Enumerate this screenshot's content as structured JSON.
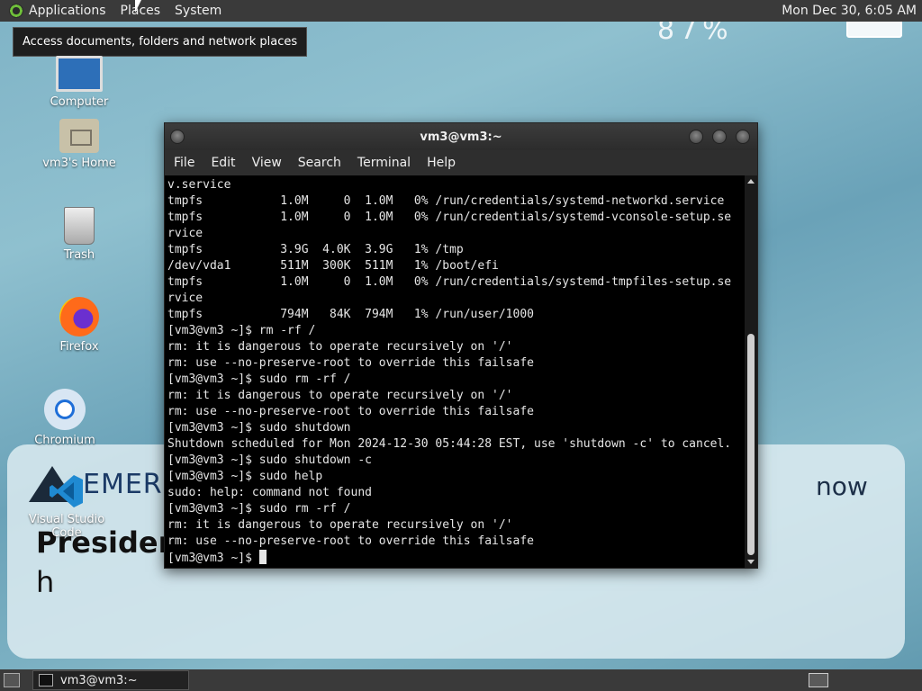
{
  "top_panel": {
    "menus": [
      "Applications",
      "Places",
      "System"
    ],
    "clock": "Mon Dec 30,  6:05 AM"
  },
  "tooltip": "Access documents, folders and network places",
  "wallpaper": {
    "brand": "EMER",
    "now": "now",
    "presider": "Presider",
    "h": "h",
    "status_text": "87%"
  },
  "desktop_icons": [
    {
      "label": "Computer",
      "icon": "computer-icon"
    },
    {
      "label": "vm3's Home",
      "icon": "home-folder-icon"
    },
    {
      "label": "Trash",
      "icon": "trash-icon"
    },
    {
      "label": "Firefox",
      "icon": "firefox-icon"
    },
    {
      "label": "Chromium",
      "icon": "chromium-icon"
    },
    {
      "label": "Visual Studio Code",
      "icon": "vscode-icon"
    }
  ],
  "terminal": {
    "title": "vm3@vm3:~",
    "menu": [
      "File",
      "Edit",
      "View",
      "Search",
      "Terminal",
      "Help"
    ],
    "lines": [
      "v.service",
      "tmpfs           1.0M     0  1.0M   0% /run/credentials/systemd-networkd.service",
      "tmpfs           1.0M     0  1.0M   0% /run/credentials/systemd-vconsole-setup.se",
      "rvice",
      "tmpfs           3.9G  4.0K  3.9G   1% /tmp",
      "/dev/vda1       511M  300K  511M   1% /boot/efi",
      "tmpfs           1.0M     0  1.0M   0% /run/credentials/systemd-tmpfiles-setup.se",
      "rvice",
      "tmpfs           794M   84K  794M   1% /run/user/1000",
      "[vm3@vm3 ~]$ rm -rf /",
      "rm: it is dangerous to operate recursively on '/'",
      "rm: use --no-preserve-root to override this failsafe",
      "[vm3@vm3 ~]$ sudo rm -rf /",
      "rm: it is dangerous to operate recursively on '/'",
      "rm: use --no-preserve-root to override this failsafe",
      "[vm3@vm3 ~]$ sudo shutdown",
      "Shutdown scheduled for Mon 2024-12-30 05:44:28 EST, use 'shutdown -c' to cancel.",
      "[vm3@vm3 ~]$ sudo shutdown -c",
      "[vm3@vm3 ~]$ sudo help",
      "sudo: help: command not found",
      "[vm3@vm3 ~]$ sudo rm -rf /",
      "rm: it is dangerous to operate recursively on '/'",
      "rm: use --no-preserve-root to override this failsafe"
    ],
    "prompt": "[vm3@vm3 ~]$ "
  },
  "bottom_panel": {
    "task_label": "vm3@vm3:~"
  },
  "colors": {
    "panel": "#3a3a3a",
    "terminal_bg": "#000000",
    "terminal_fg": "#e6e6e6"
  }
}
